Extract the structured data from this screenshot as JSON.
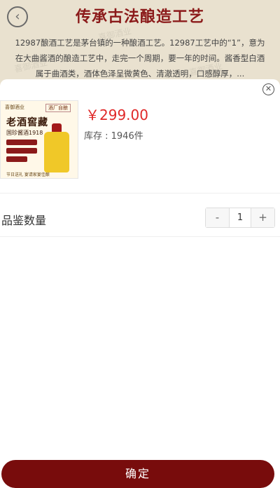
{
  "header": {
    "title": "传承古法酿造工艺",
    "description": "12987酿酒工艺是茅台镇的一种酿酒工艺。12987工艺中的“1”，意为在大曲酱酒的酿造工艺中，走完一个周期，要一年的时间。酱香型白酒属于曲酒类，酒体色泽呈微黄色、清澈透明，口感醇厚，..."
  },
  "product": {
    "thumb_brand": "喜御酒业",
    "thumb_tag": "酒厂自酿",
    "thumb_title": "老酒窖藏",
    "thumb_subtitle": "国珍酱酒1918",
    "thumb_footer": "节日送礼 宴请家宴佳酿",
    "price": "￥299.00",
    "stock": "库存 : 1946件"
  },
  "quantity": {
    "label": "品鉴数量",
    "minus": "-",
    "value": "1",
    "plus": "+"
  },
  "actions": {
    "confirm": "确定"
  },
  "icons": {
    "back": "back-icon",
    "close": "close-icon"
  },
  "colors": {
    "accent": "#780c0c",
    "price": "#e02828",
    "title": "#8b1a1a"
  }
}
